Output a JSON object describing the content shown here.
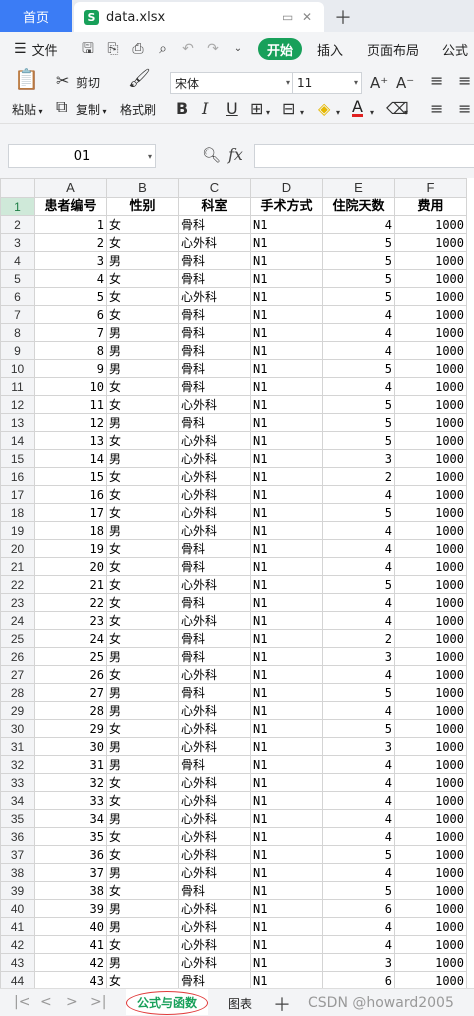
{
  "tabs": {
    "home": "首页",
    "file": "data.xlsx"
  },
  "menu": {
    "file": "文件",
    "start": "开始",
    "insert": "插入",
    "page_layout": "页面布局",
    "formula": "公式"
  },
  "ribbon": {
    "paste": "粘贴",
    "cut": "剪切",
    "copy": "复制",
    "format_painter": "格式刷",
    "font_name": "宋体",
    "font_size": "11"
  },
  "formula_bar": {
    "name_box": "01",
    "fx": "fx",
    "value": ""
  },
  "columns": [
    "A",
    "B",
    "C",
    "D",
    "E",
    "F"
  ],
  "headers": [
    "患者编号",
    "性别",
    "科室",
    "手术方式",
    "住院天数",
    "费用"
  ],
  "rows": [
    [
      "1",
      "女",
      "骨科",
      "N1",
      "4",
      "1000"
    ],
    [
      "2",
      "女",
      "心外科",
      "N1",
      "5",
      "1000"
    ],
    [
      "3",
      "男",
      "骨科",
      "N1",
      "5",
      "1000"
    ],
    [
      "4",
      "女",
      "骨科",
      "N1",
      "5",
      "1000"
    ],
    [
      "5",
      "女",
      "心外科",
      "N1",
      "5",
      "1000"
    ],
    [
      "6",
      "女",
      "骨科",
      "N1",
      "4",
      "1000"
    ],
    [
      "7",
      "男",
      "骨科",
      "N1",
      "4",
      "1000"
    ],
    [
      "8",
      "男",
      "骨科",
      "N1",
      "4",
      "1000"
    ],
    [
      "9",
      "男",
      "骨科",
      "N1",
      "5",
      "1000"
    ],
    [
      "10",
      "女",
      "骨科",
      "N1",
      "4",
      "1000"
    ],
    [
      "11",
      "女",
      "心外科",
      "N1",
      "5",
      "1000"
    ],
    [
      "12",
      "男",
      "骨科",
      "N1",
      "5",
      "1000"
    ],
    [
      "13",
      "女",
      "心外科",
      "N1",
      "5",
      "1000"
    ],
    [
      "14",
      "男",
      "心外科",
      "N1",
      "3",
      "1000"
    ],
    [
      "15",
      "女",
      "心外科",
      "N1",
      "2",
      "1000"
    ],
    [
      "16",
      "女",
      "心外科",
      "N1",
      "4",
      "1000"
    ],
    [
      "17",
      "女",
      "心外科",
      "N1",
      "5",
      "1000"
    ],
    [
      "18",
      "男",
      "心外科",
      "N1",
      "4",
      "1000"
    ],
    [
      "19",
      "女",
      "骨科",
      "N1",
      "4",
      "1000"
    ],
    [
      "20",
      "女",
      "骨科",
      "N1",
      "4",
      "1000"
    ],
    [
      "21",
      "女",
      "心外科",
      "N1",
      "5",
      "1000"
    ],
    [
      "22",
      "女",
      "骨科",
      "N1",
      "4",
      "1000"
    ],
    [
      "23",
      "女",
      "心外科",
      "N1",
      "4",
      "1000"
    ],
    [
      "24",
      "女",
      "骨科",
      "N1",
      "2",
      "1000"
    ],
    [
      "25",
      "男",
      "骨科",
      "N1",
      "3",
      "1000"
    ],
    [
      "26",
      "女",
      "心外科",
      "N1",
      "4",
      "1000"
    ],
    [
      "27",
      "男",
      "骨科",
      "N1",
      "5",
      "1000"
    ],
    [
      "28",
      "男",
      "心外科",
      "N1",
      "4",
      "1000"
    ],
    [
      "29",
      "女",
      "心外科",
      "N1",
      "5",
      "1000"
    ],
    [
      "30",
      "男",
      "心外科",
      "N1",
      "3",
      "1000"
    ],
    [
      "31",
      "男",
      "骨科",
      "N1",
      "4",
      "1000"
    ],
    [
      "32",
      "女",
      "心外科",
      "N1",
      "4",
      "1000"
    ],
    [
      "33",
      "女",
      "心外科",
      "N1",
      "4",
      "1000"
    ],
    [
      "34",
      "男",
      "心外科",
      "N1",
      "4",
      "1000"
    ],
    [
      "35",
      "女",
      "心外科",
      "N1",
      "4",
      "1000"
    ],
    [
      "36",
      "女",
      "心外科",
      "N1",
      "5",
      "1000"
    ],
    [
      "37",
      "男",
      "心外科",
      "N1",
      "4",
      "1000"
    ],
    [
      "38",
      "女",
      "骨科",
      "N1",
      "5",
      "1000"
    ],
    [
      "39",
      "男",
      "心外科",
      "N1",
      "6",
      "1000"
    ],
    [
      "40",
      "男",
      "心外科",
      "N1",
      "4",
      "1000"
    ],
    [
      "41",
      "女",
      "心外科",
      "N1",
      "4",
      "1000"
    ],
    [
      "42",
      "男",
      "心外科",
      "N1",
      "3",
      "1000"
    ],
    [
      "43",
      "女",
      "骨科",
      "N1",
      "6",
      "1000"
    ]
  ],
  "sheets": [
    "公式与函数",
    "图表"
  ],
  "watermark": "CSDN @howard2005",
  "colors": {
    "accent": "#18a05a",
    "home_tab": "#3b7cf5",
    "highlight_ring": "#e03b3b"
  }
}
